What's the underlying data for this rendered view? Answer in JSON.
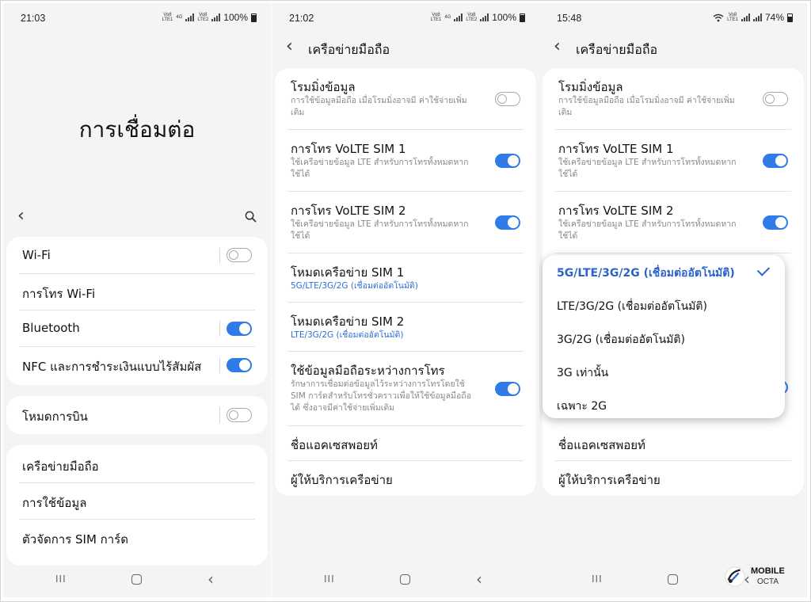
{
  "screens": [
    {
      "status": {
        "time": "21:03",
        "battery": "100%",
        "sim1": "LTE1",
        "sim2": "LTE2",
        "volte": "Vo8",
        "net": "4G"
      },
      "title": "การเชื่อมต่อ",
      "group1": [
        {
          "label": "Wi-Fi",
          "toggle": "off"
        },
        {
          "label": "การโทร Wi-Fi"
        },
        {
          "label": "Bluetooth",
          "toggle": "on"
        },
        {
          "label": "NFC และการชำระเงินแบบไร้สัมผัส",
          "toggle": "on"
        }
      ],
      "group2": [
        {
          "label": "โหมดการบิน",
          "toggle": "off"
        }
      ],
      "group3": [
        {
          "label": "เครือข่ายมือถือ"
        },
        {
          "label": "การใช้ข้อมูล"
        },
        {
          "label": "ตัวจัดการ SIM การ์ด"
        }
      ]
    },
    {
      "status": {
        "time": "21:02",
        "battery": "100%",
        "sim1": "LTE1",
        "sim2": "LTE2",
        "volte": "Vo8",
        "net": "4G"
      },
      "title": "เครือข่ายมือถือ",
      "items": [
        {
          "label": "โรมมิ่งข้อมูล",
          "sub": "การใช้ข้อมูลมือถือ เมื่อโรมมิ่งอาจมี ค่าใช้จ่ายเพิ่มเติม",
          "toggle": "off"
        },
        {
          "label": "การโทร VoLTE SIM 1",
          "sub": "ใช้เครือข่ายข้อมูล LTE สำหรับการโทรทั้งหมดหากใช้ได้",
          "toggle": "on"
        },
        {
          "label": "การโทร VoLTE SIM 2",
          "sub": "ใช้เครือข่ายข้อมูล LTE สำหรับการโทรทั้งหมดหากใช้ได้",
          "toggle": "on"
        },
        {
          "label": "โหมดเครือข่าย SIM 1",
          "sub": "5G/LTE/3G/2G (เชื่อมต่ออัตโนมัติ)"
        },
        {
          "label": "โหมดเครือข่าย SIM 2",
          "sub": "LTE/3G/2G (เชื่อมต่ออัตโนมัติ)"
        },
        {
          "label": "ใช้ข้อมูลมือถือระหว่างการโทร",
          "sub": "รักษาการเชื่อมต่อข้อมูลไว้ระหว่างการโทรโดยใช้ SIM การ์ดสำหรับโทรชั่วคราวเพื่อให้ใช้ข้อมูลมือถือได้ ซึ่งอาจมีค่าใช้จ่ายเพิ่มเติม",
          "toggle": "on"
        },
        {
          "label": "ชื่อแอคเซสพอยท์"
        },
        {
          "label": "ผู้ให้บริการเครือข่าย"
        }
      ]
    },
    {
      "status": {
        "time": "15:48",
        "battery": "74%",
        "sim1": "LTE1",
        "volte": "Vo8"
      },
      "title": "เครือข่ายมือถือ",
      "items": [
        {
          "label": "โรมมิ่งข้อมูล",
          "sub": "การใช้ข้อมูลมือถือ เมื่อโรมมิ่งอาจมี ค่าใช้จ่ายเพิ่มเติม",
          "toggle": "off"
        },
        {
          "label": "การโทร VoLTE SIM 1",
          "sub": "ใช้เครือข่ายข้อมูล LTE สำหรับการโทรทั้งหมดหากใช้ได้",
          "toggle": "on"
        },
        {
          "label": "การโทร VoLTE SIM 2",
          "sub": "ใช้เครือข่ายข้อมูล LTE สำหรับการโทรทั้งหมดหากใช้ได้",
          "toggle": "on"
        },
        {
          "label": "ชื่อแอคเซสพอยท์"
        },
        {
          "label": "ผู้ให้บริการเครือข่าย"
        }
      ],
      "dropdown": [
        {
          "label": "5G/LTE/3G/2G (เชื่อมต่ออัตโนมัติ)",
          "selected": true
        },
        {
          "label": "LTE/3G/2G (เชื่อมต่ออัตโนมัติ)"
        },
        {
          "label": "3G/2G (เชื่อมต่ออัตโนมัติ)"
        },
        {
          "label": "3G เท่านั้น"
        },
        {
          "label": "เฉพาะ 2G"
        }
      ]
    }
  ],
  "watermark": {
    "line1": "MOBILE",
    "line2": "OCTA"
  },
  "colors": {
    "accent": "#2f7ce8",
    "selected": "#2d62c8",
    "background": "#f4f4f4",
    "card": "#ffffff"
  }
}
